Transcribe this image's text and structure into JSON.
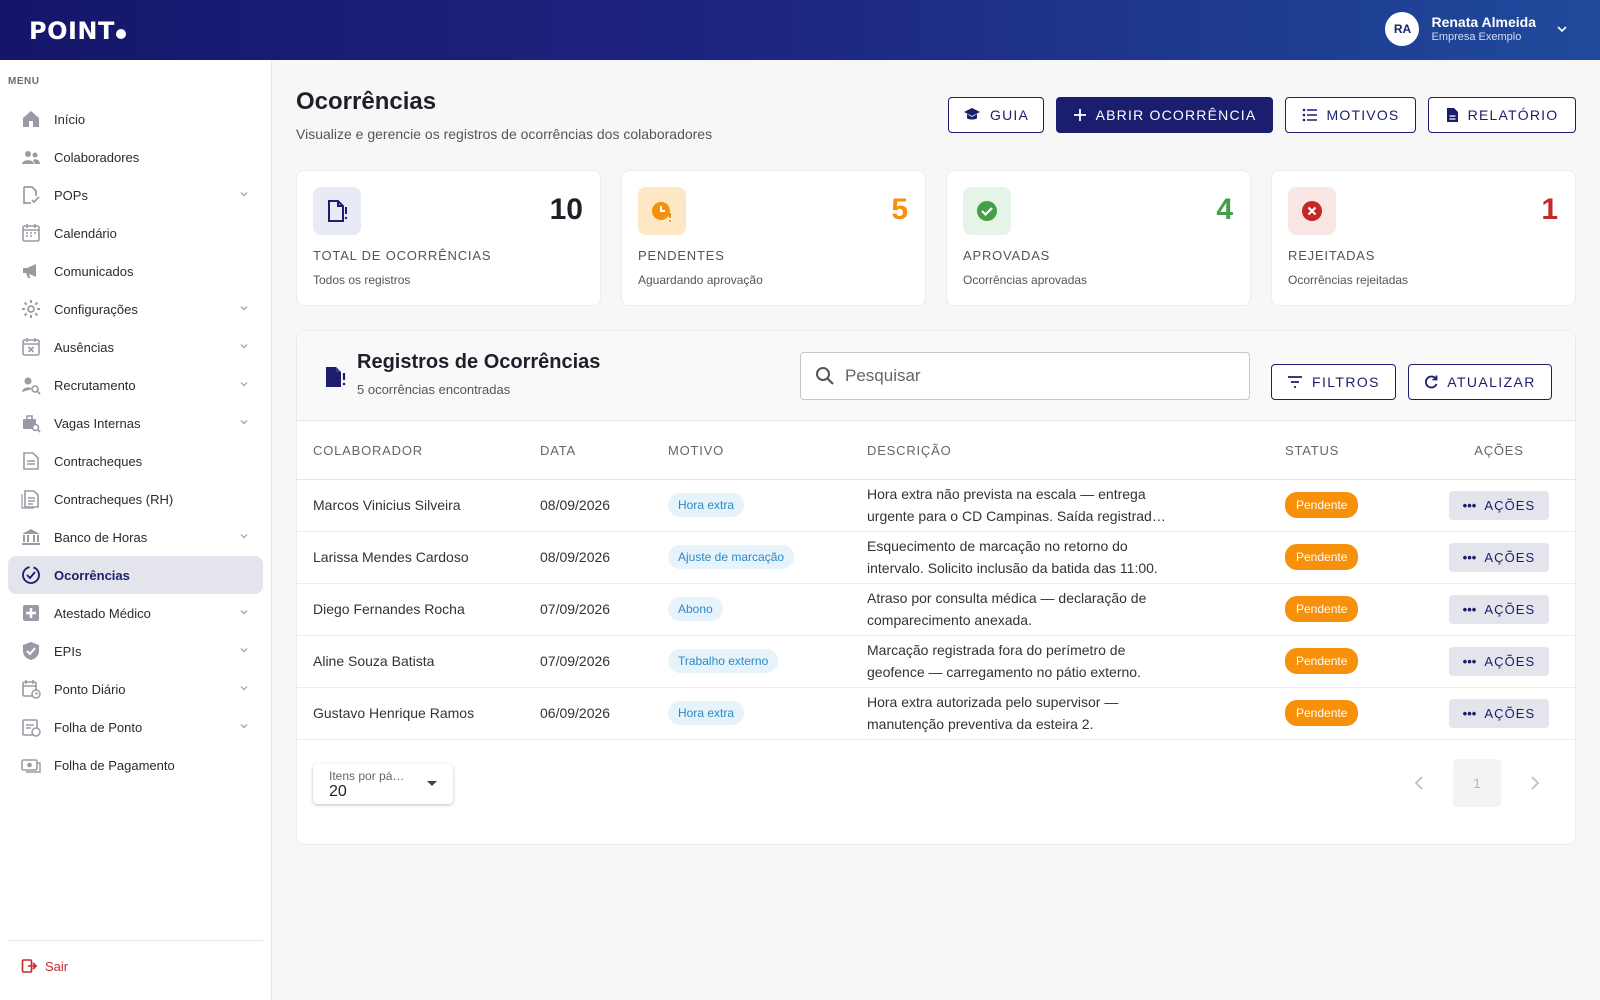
{
  "header": {
    "logo": "POINT",
    "user_initials": "RA",
    "user_name": "Renata Almeida",
    "user_company": "Empresa Exemplo"
  },
  "sidebar": {
    "menu_label": "MENU",
    "items": [
      {
        "label": "Início",
        "icon": "home-icon"
      },
      {
        "label": "Colaboradores",
        "icon": "people-icon"
      },
      {
        "label": "POPs",
        "icon": "document-check-icon",
        "expandable": true
      },
      {
        "label": "Calendário",
        "icon": "calendar-icon"
      },
      {
        "label": "Comunicados",
        "icon": "megaphone-icon"
      },
      {
        "label": "Configurações",
        "icon": "gear-icon",
        "expandable": true
      },
      {
        "label": "Ausências",
        "icon": "calendar-x-icon",
        "expandable": true
      },
      {
        "label": "Recrutamento",
        "icon": "person-search-icon",
        "expandable": true
      },
      {
        "label": "Vagas Internas",
        "icon": "briefcase-search-icon",
        "expandable": true
      },
      {
        "label": "Contracheques",
        "icon": "receipt-icon"
      },
      {
        "label": "Contracheques (RH)",
        "icon": "receipt-list-icon"
      },
      {
        "label": "Banco de Horas",
        "icon": "bank-icon",
        "expandable": true
      },
      {
        "label": "Ocorrências",
        "icon": "check-badge-icon",
        "active": true
      },
      {
        "label": "Atestado Médico",
        "icon": "medical-plus-icon",
        "expandable": true
      },
      {
        "label": "EPIs",
        "icon": "shield-check-icon",
        "expandable": true
      },
      {
        "label": "Ponto Diário",
        "icon": "calendar-clock-icon",
        "expandable": true
      },
      {
        "label": "Folha de Ponto",
        "icon": "timesheet-icon",
        "expandable": true
      },
      {
        "label": "Folha de Pagamento",
        "icon": "payment-icon"
      }
    ],
    "logout_label": "Sair"
  },
  "page": {
    "title": "Ocorrências",
    "subtitle": "Visualize e gerencie os registros de ocorrências dos colaboradores",
    "buttons": {
      "guide": "GUIA",
      "open": "ABRIR OCORRÊNCIA",
      "reasons": "MOTIVOS",
      "report": "RELATÓRIO"
    }
  },
  "stats": [
    {
      "value": "10",
      "label": "TOTAL DE OCORRÊNCIAS",
      "desc": "Todos os registros",
      "color": "#1f1f2a"
    },
    {
      "value": "5",
      "label": "PENDENTES",
      "desc": "Aguardando aprovação",
      "color": "#f7900a"
    },
    {
      "value": "4",
      "label": "APROVADAS",
      "desc": "Ocorrências aprovadas",
      "color": "#43a047"
    },
    {
      "value": "1",
      "label": "REJEITADAS",
      "desc": "Ocorrências rejeitadas",
      "color": "#c62828"
    }
  ],
  "records": {
    "title": "Registros de Ocorrências",
    "count_text": "5 ocorrências encontradas",
    "search_placeholder": "Pesquisar",
    "filters_label": "FILTROS",
    "refresh_label": "ATUALIZAR",
    "columns": [
      "COLABORADOR",
      "DATA",
      "MOTIVO",
      "DESCRIÇÃO",
      "STATUS",
      "AÇÕES"
    ],
    "rows": [
      {
        "name": "Marcos Vinicius Silveira",
        "date": "08/09/2026",
        "reason": "Hora extra",
        "description": "Hora extra não prevista na escala — entrega urgente para o CD Campinas. Saída registrada após o horário previsto.",
        "status": "Pendente",
        "action": "AÇÕES"
      },
      {
        "name": "Larissa Mendes Cardoso",
        "date": "08/09/2026",
        "reason": "Ajuste de marcação",
        "description": "Esquecimento de marcação no retorno do intervalo. Solicito inclusão da batida das 11:00.",
        "status": "Pendente",
        "action": "AÇÕES"
      },
      {
        "name": "Diego Fernandes Rocha",
        "date": "07/09/2026",
        "reason": "Abono",
        "description": "Atraso por consulta médica — declaração de comparecimento anexada.",
        "status": "Pendente",
        "action": "AÇÕES"
      },
      {
        "name": "Aline Souza Batista",
        "date": "07/09/2026",
        "reason": "Trabalho externo",
        "description": "Marcação registrada fora do perímetro de geofence — carregamento no pátio externo.",
        "status": "Pendente",
        "action": "AÇÕES"
      },
      {
        "name": "Gustavo Henrique Ramos",
        "date": "06/09/2026",
        "reason": "Hora extra",
        "description": "Hora extra autorizada pelo supervisor — manutenção preventiva da esteira 2.",
        "status": "Pendente",
        "action": "AÇÕES"
      }
    ],
    "per_page_label": "Itens por pá…",
    "per_page_value": "20",
    "current_page": "1"
  },
  "colors": {
    "brand": "#1b1e6e",
    "pending": "#f7900a",
    "approved": "#43a047",
    "rejected": "#c62828"
  }
}
